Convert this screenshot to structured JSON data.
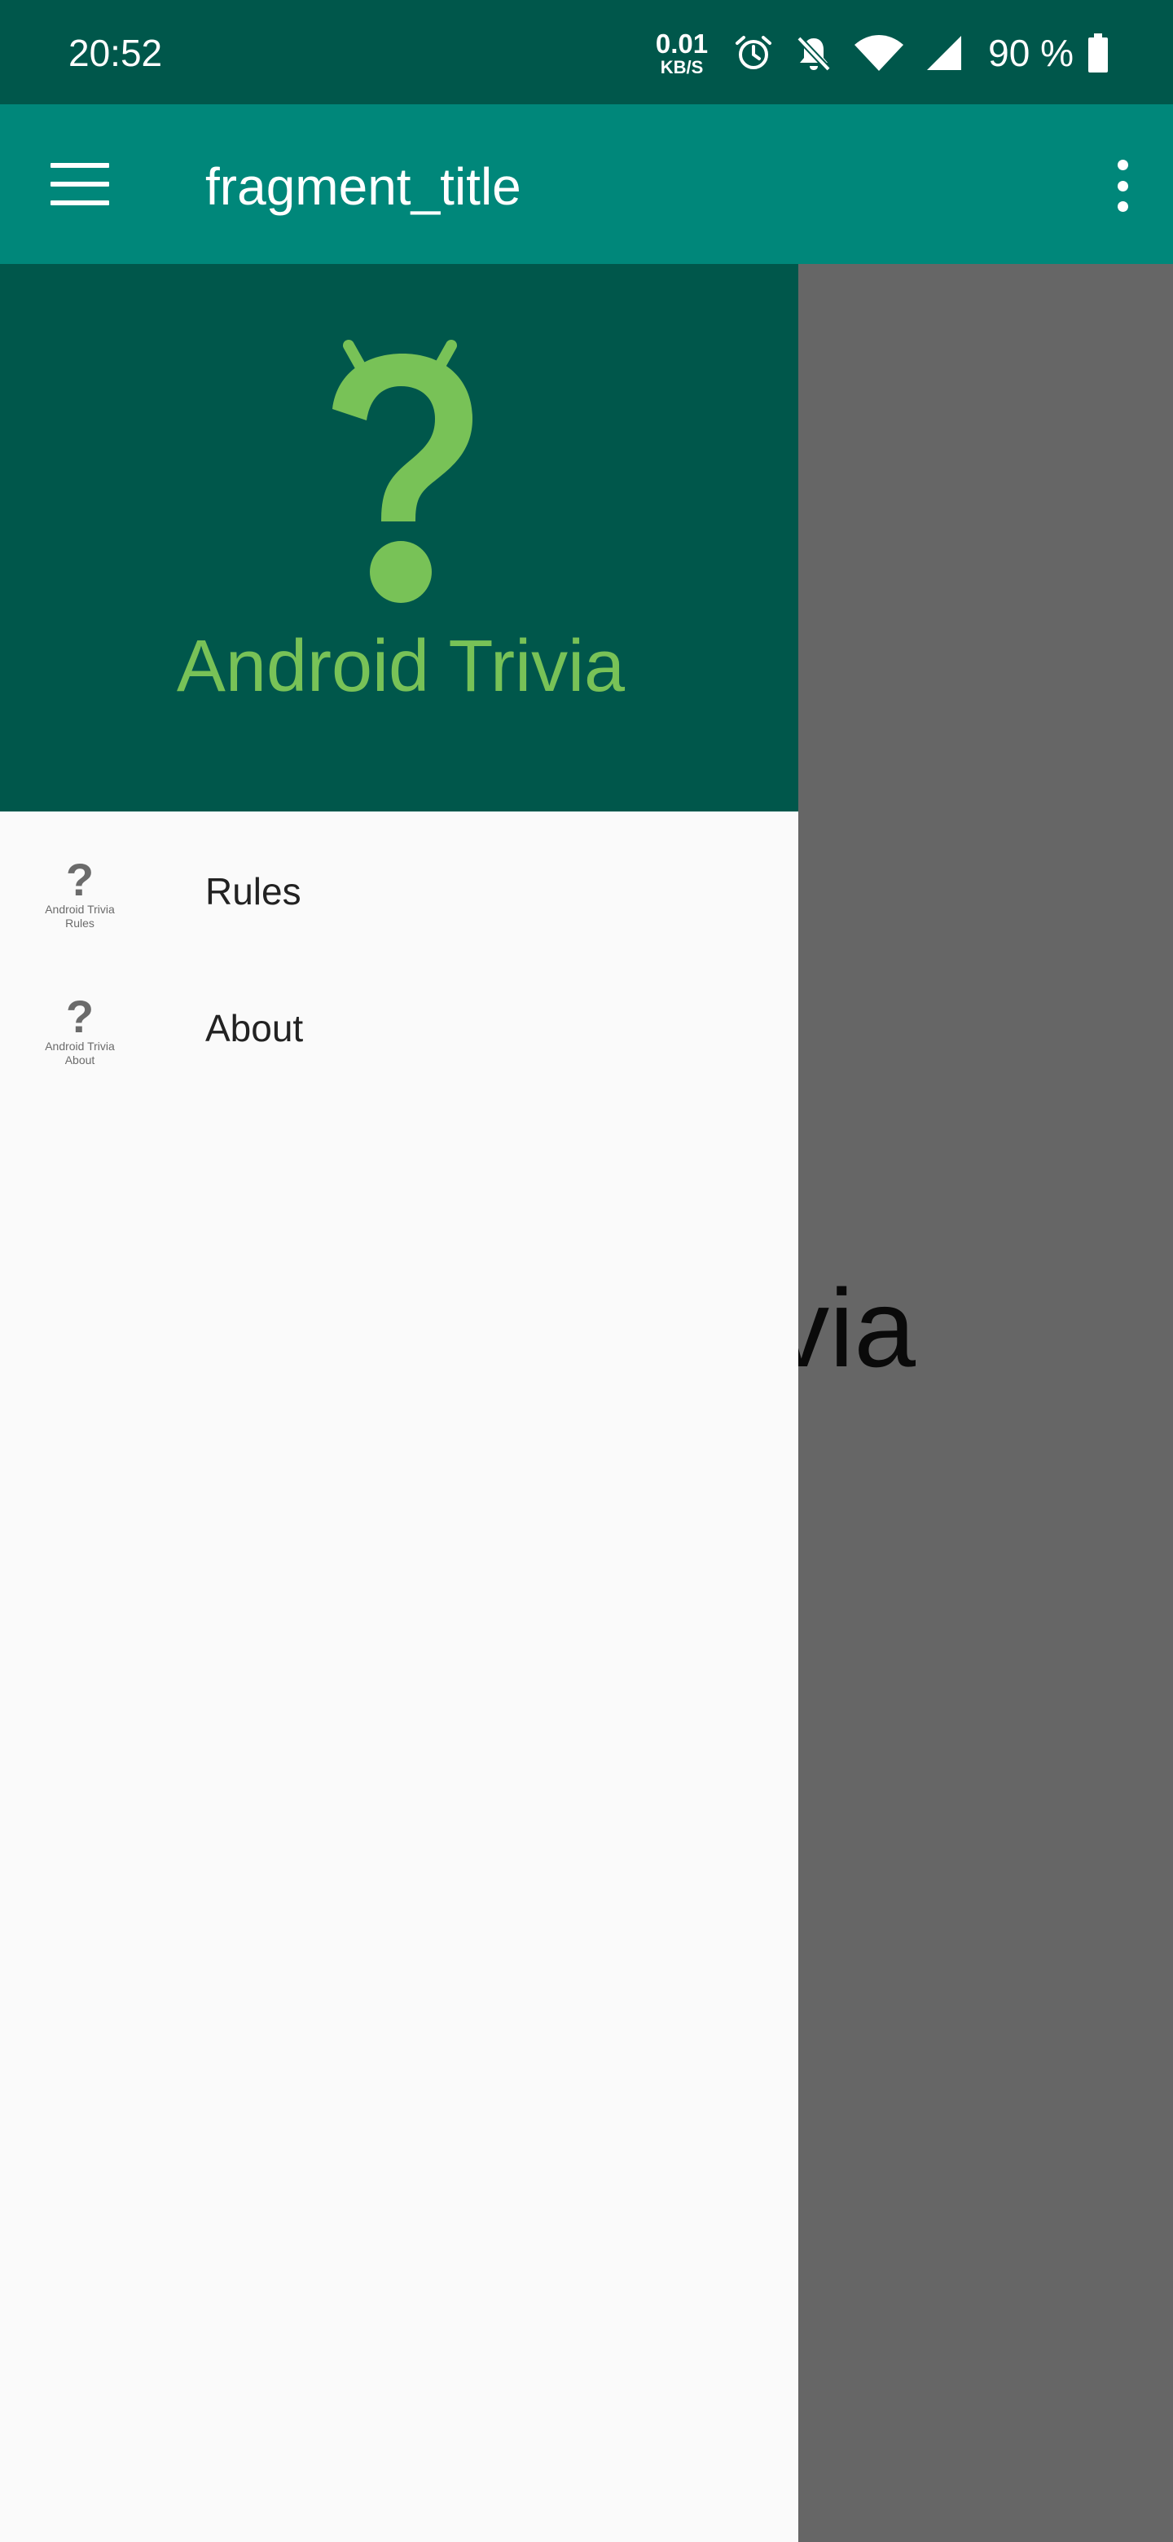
{
  "status_bar": {
    "time": "20:52",
    "net_speed_value": "0.01",
    "net_speed_unit": "KB/S",
    "battery_percent": "90 %",
    "icons": [
      "alarm-icon",
      "bell-off-icon",
      "wifi-icon",
      "cell-signal-icon",
      "battery-icon"
    ]
  },
  "app_bar": {
    "title": "fragment_title",
    "nav_icon": "menu-icon",
    "overflow_icon": "more-vert-icon"
  },
  "background": {
    "title_fragment": "via"
  },
  "drawer": {
    "header_title": "Android Trivia",
    "items": [
      {
        "label": "Rules",
        "icon_caption_1": "Android Trivia",
        "icon_caption_2": "Rules"
      },
      {
        "label": "About",
        "icon_caption_1": "Android Trivia",
        "icon_caption_2": "About"
      }
    ]
  },
  "colors": {
    "status_bar": "#00574b",
    "app_bar": "#00877a",
    "drawer_header": "#00574b",
    "logo_green": "#78c257",
    "drawer_bg": "#fafafa"
  }
}
